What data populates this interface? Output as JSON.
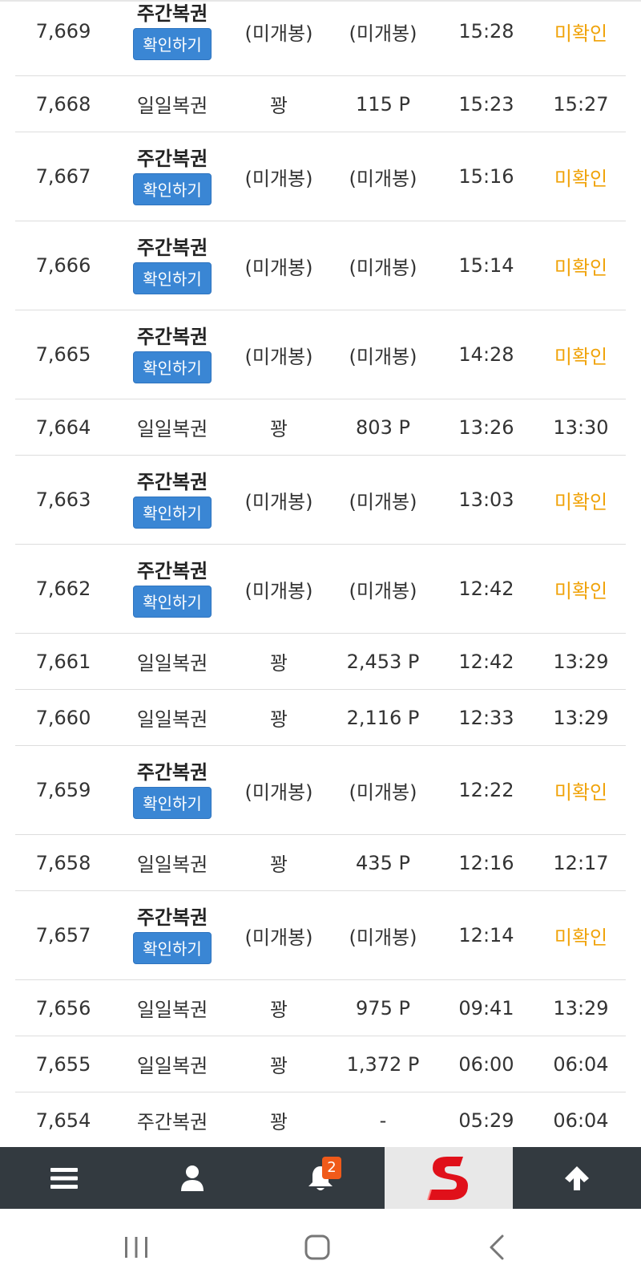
{
  "rows": [
    {
      "no": "7,669",
      "type": "주간복권",
      "button": "확인하기",
      "result": "(미개봉)",
      "points": "(미개봉)",
      "time1": "15:28",
      "time2": "미확인",
      "weekly": true
    },
    {
      "no": "7,668",
      "type": "일일복권",
      "button": "",
      "result": "꽝",
      "points": "115 P",
      "time1": "15:23",
      "time2": "15:27",
      "weekly": false
    },
    {
      "no": "7,667",
      "type": "주간복권",
      "button": "확인하기",
      "result": "(미개봉)",
      "points": "(미개봉)",
      "time1": "15:16",
      "time2": "미확인",
      "weekly": true
    },
    {
      "no": "7,666",
      "type": "주간복권",
      "button": "확인하기",
      "result": "(미개봉)",
      "points": "(미개봉)",
      "time1": "15:14",
      "time2": "미확인",
      "weekly": true
    },
    {
      "no": "7,665",
      "type": "주간복권",
      "button": "확인하기",
      "result": "(미개봉)",
      "points": "(미개봉)",
      "time1": "14:28",
      "time2": "미확인",
      "weekly": true
    },
    {
      "no": "7,664",
      "type": "일일복권",
      "button": "",
      "result": "꽝",
      "points": "803 P",
      "time1": "13:26",
      "time2": "13:30",
      "weekly": false
    },
    {
      "no": "7,663",
      "type": "주간복권",
      "button": "확인하기",
      "result": "(미개봉)",
      "points": "(미개봉)",
      "time1": "13:03",
      "time2": "미확인",
      "weekly": true
    },
    {
      "no": "7,662",
      "type": "주간복권",
      "button": "확인하기",
      "result": "(미개봉)",
      "points": "(미개봉)",
      "time1": "12:42",
      "time2": "미확인",
      "weekly": true
    },
    {
      "no": "7,661",
      "type": "일일복권",
      "button": "",
      "result": "꽝",
      "points": "2,453 P",
      "time1": "12:42",
      "time2": "13:29",
      "weekly": false
    },
    {
      "no": "7,660",
      "type": "일일복권",
      "button": "",
      "result": "꽝",
      "points": "2,116 P",
      "time1": "12:33",
      "time2": "13:29",
      "weekly": false
    },
    {
      "no": "7,659",
      "type": "주간복권",
      "button": "확인하기",
      "result": "(미개봉)",
      "points": "(미개봉)",
      "time1": "12:22",
      "time2": "미확인",
      "weekly": true
    },
    {
      "no": "7,658",
      "type": "일일복권",
      "button": "",
      "result": "꽝",
      "points": "435 P",
      "time1": "12:16",
      "time2": "12:17",
      "weekly": false
    },
    {
      "no": "7,657",
      "type": "주간복권",
      "button": "확인하기",
      "result": "(미개봉)",
      "points": "(미개봉)",
      "time1": "12:14",
      "time2": "미확인",
      "weekly": true
    },
    {
      "no": "7,656",
      "type": "일일복권",
      "button": "",
      "result": "꽝",
      "points": "975 P",
      "time1": "09:41",
      "time2": "13:29",
      "weekly": false
    },
    {
      "no": "7,655",
      "type": "일일복권",
      "button": "",
      "result": "꽝",
      "points": "1,372 P",
      "time1": "06:00",
      "time2": "06:04",
      "weekly": false
    },
    {
      "no": "7,654",
      "type": "주간복권",
      "button": "",
      "result": "꽝",
      "points": "-",
      "time1": "05:29",
      "time2": "06:04",
      "weekly": false
    }
  ],
  "bottom_nav": {
    "notification_count": "2",
    "logo_letter": "S",
    "items": [
      "menu-icon",
      "user-icon",
      "bell-icon",
      "logo",
      "arrow-up-icon"
    ]
  },
  "colors": {
    "pending": "#f0a30a",
    "button": "#3a86d4",
    "nav_bg": "#333a40",
    "badge": "#f05a1a",
    "logo": "#e0101a"
  }
}
